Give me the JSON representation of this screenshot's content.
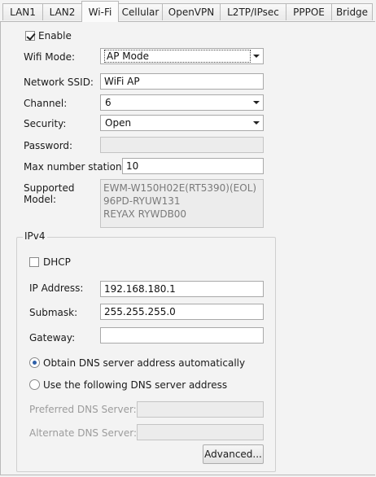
{
  "tabs": [
    {
      "label": "LAN1"
    },
    {
      "label": "LAN2"
    },
    {
      "label": "Wi-Fi"
    },
    {
      "label": "Cellular"
    },
    {
      "label": "OpenVPN"
    },
    {
      "label": "L2TP/IPsec"
    },
    {
      "label": "PPPOE"
    },
    {
      "label": "Bridge"
    }
  ],
  "active_tab": "Wi-Fi",
  "wifi": {
    "enable_label": "Enable",
    "enable_checked": true,
    "mode_label": "Wifi Mode:",
    "mode_value": "AP Mode",
    "ssid_label": "Network SSID:",
    "ssid_value": "WiFi AP",
    "channel_label": "Channel:",
    "channel_value": "6",
    "security_label": "Security:",
    "security_value": "Open",
    "password_label": "Password:",
    "password_value": "",
    "max_station_label": "Max number station:",
    "max_station_value": "10",
    "supported_label_1": "Supported",
    "supported_label_2": "Model:",
    "supported_models": [
      "EWM-W150H02E(RT5390)(EOL)",
      "96PD-RYUW131",
      "REYAX RYWDB00"
    ]
  },
  "ipv4": {
    "title": "IPv4",
    "dhcp_label": "DHCP",
    "dhcp_checked": false,
    "ip_label": "IP Address:",
    "ip_value": "192.168.180.1",
    "submask_label": "Submask:",
    "submask_value": "255.255.255.0",
    "gateway_label": "Gateway:",
    "gateway_value": "",
    "dns_auto_label": "Obtain DNS server address automatically",
    "dns_manual_label": "Use the following DNS server address",
    "dns_selected": "auto",
    "preferred_dns_label": "Preferred DNS Server:",
    "preferred_dns_value": "",
    "alternate_dns_label": "Alternate DNS Server:",
    "alternate_dns_value": "",
    "advanced_button": "Advanced..."
  }
}
